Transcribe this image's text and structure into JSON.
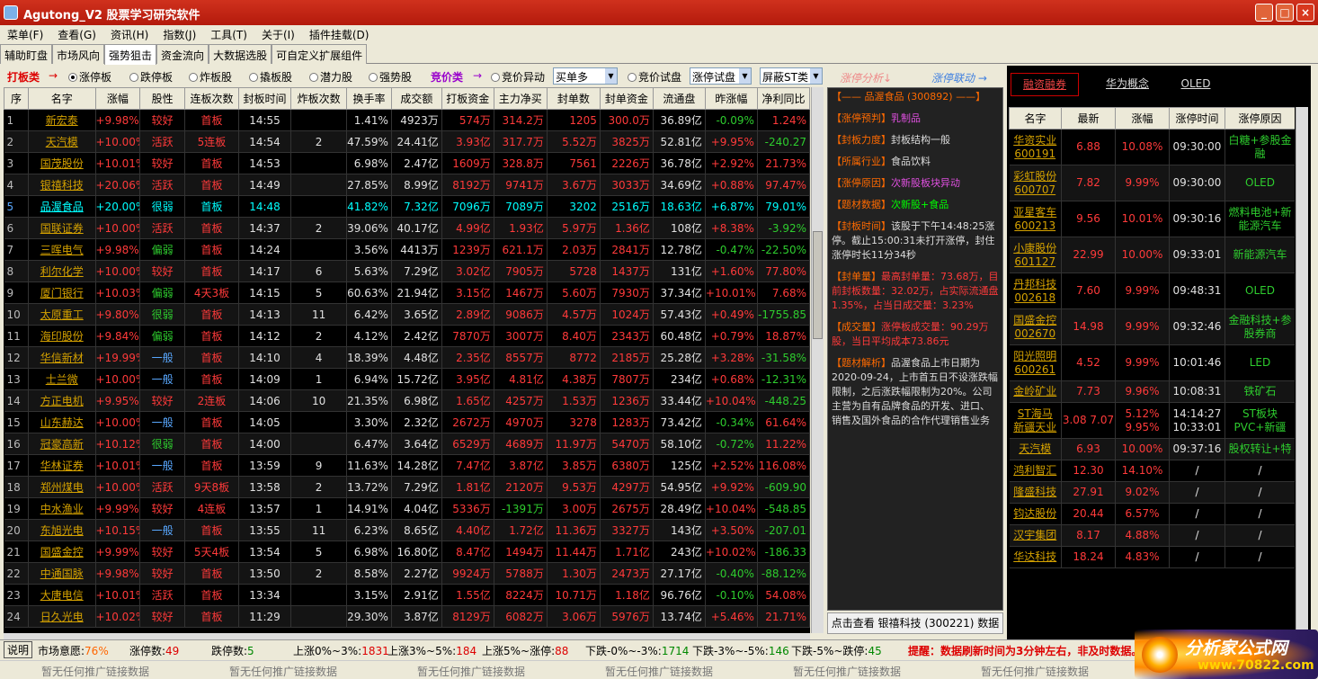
{
  "window": {
    "title": "Agutong_V2 股票学习研究软件",
    "btn_min": "_",
    "btn_max": "□",
    "btn_close": "×"
  },
  "menu": [
    "菜单(F)",
    "查看(G)",
    "资讯(H)",
    "指数(J)",
    "工具(T)",
    "关于(I)",
    "插件挂载(D)"
  ],
  "tabs": [
    "辅助盯盘",
    "市场风向",
    "强势狙击",
    "资金流向",
    "大数据选股",
    "可自定义扩展组件"
  ],
  "filters": {
    "dabanlei": "打板类",
    "arrow1": "→",
    "r1": "涨停板",
    "r2": "跌停板",
    "r3": "炸板股",
    "r4": "撬板股",
    "r5": "潜力股",
    "r6": "强势股",
    "jingjialei": "竞价类",
    "arrow2": "→",
    "r7": "竞价异动",
    "sel1": "买单多",
    "r8": "竞价试盘",
    "sel2": "涨停试盘",
    "sel3": "屏蔽ST类"
  },
  "columns": [
    "序",
    "名字",
    "涨幅",
    "股性",
    "连板次数",
    "封板时间",
    "炸板次数",
    "换手率",
    "成交额",
    "打板资金",
    "主力净买",
    "封单数",
    "封单资金",
    "流通盘",
    "昨涨幅",
    "净利同比"
  ],
  "rows": [
    [
      "1",
      "新宏泰",
      "+9.98%",
      "较好",
      "首板",
      "14:55",
      "",
      "1.41%",
      "4923万",
      "574万",
      "314.2万",
      "1205",
      "300.0万",
      "36.89亿",
      "-0.09%",
      "1.24%"
    ],
    [
      "2",
      "天汽模",
      "+10.00%",
      "活跃",
      "5连板",
      "14:54",
      "2",
      "47.59%",
      "24.41亿",
      "3.93亿",
      "317.7万",
      "5.52万",
      "3825万",
      "52.81亿",
      "+9.95%",
      "-240.27"
    ],
    [
      "3",
      "国茂股份",
      "+10.01%",
      "较好",
      "首板",
      "14:53",
      "",
      "6.98%",
      "2.47亿",
      "1609万",
      "328.8万",
      "7561",
      "2226万",
      "36.78亿",
      "+2.92%",
      "21.73%"
    ],
    [
      "4",
      "银禧科技",
      "+20.06%",
      "活跃",
      "首板",
      "14:49",
      "",
      "27.85%",
      "8.99亿",
      "8192万",
      "9741万",
      "3.67万",
      "3033万",
      "34.69亿",
      "+0.88%",
      "97.47%"
    ],
    [
      "5",
      "品渥食品",
      "+20.00%",
      "很弱",
      "首板",
      "14:48",
      "",
      "41.82%",
      "7.32亿",
      "7096万",
      "7089万",
      "3202",
      "2516万",
      "18.63亿",
      "+6.87%",
      "79.01%"
    ],
    [
      "6",
      "国联证券",
      "+10.00%",
      "活跃",
      "首板",
      "14:37",
      "2",
      "39.06%",
      "40.17亿",
      "4.99亿",
      "1.93亿",
      "5.97万",
      "1.36亿",
      "108亿",
      "+8.38%",
      "-3.92%"
    ],
    [
      "7",
      "三晖电气",
      "+9.98%",
      "偏弱",
      "首板",
      "14:24",
      "",
      "3.56%",
      "4413万",
      "1239万",
      "621.1万",
      "2.03万",
      "2841万",
      "12.78亿",
      "-0.47%",
      "-22.50%"
    ],
    [
      "8",
      "利尔化学",
      "+10.00%",
      "较好",
      "首板",
      "14:17",
      "6",
      "5.63%",
      "7.29亿",
      "3.02亿",
      "7905万",
      "5728",
      "1437万",
      "131亿",
      "+1.60%",
      "77.80%"
    ],
    [
      "9",
      "厦门银行",
      "+10.03%",
      "偏弱",
      "4天3板",
      "14:15",
      "5",
      "60.63%",
      "21.94亿",
      "3.15亿",
      "1467万",
      "5.60万",
      "7930万",
      "37.34亿",
      "+10.01%",
      "7.68%"
    ],
    [
      "10",
      "太原重工",
      "+9.80%",
      "很弱",
      "首板",
      "14:13",
      "11",
      "6.42%",
      "3.65亿",
      "2.89亿",
      "9086万",
      "4.57万",
      "1024万",
      "57.43亿",
      "+0.49%",
      "-1755.85"
    ],
    [
      "11",
      "海印股份",
      "+9.84%",
      "偏弱",
      "首板",
      "14:12",
      "2",
      "4.12%",
      "2.42亿",
      "7870万",
      "3007万",
      "8.40万",
      "2343万",
      "60.48亿",
      "+0.79%",
      "18.87%"
    ],
    [
      "12",
      "华信新材",
      "+19.99%",
      "一般",
      "首板",
      "14:10",
      "4",
      "18.39%",
      "4.48亿",
      "2.35亿",
      "8557万",
      "8772",
      "2185万",
      "25.28亿",
      "+3.28%",
      "-31.58%"
    ],
    [
      "13",
      "士兰微",
      "+10.00%",
      "一般",
      "首板",
      "14:09",
      "1",
      "6.94%",
      "15.72亿",
      "3.95亿",
      "4.81亿",
      "4.38万",
      "7807万",
      "234亿",
      "+0.68%",
      "-12.31%"
    ],
    [
      "14",
      "方正电机",
      "+9.95%",
      "较好",
      "2连板",
      "14:06",
      "10",
      "21.35%",
      "6.98亿",
      "1.65亿",
      "4257万",
      "1.53万",
      "1236万",
      "33.44亿",
      "+10.04%",
      "-448.25"
    ],
    [
      "15",
      "山东赫达",
      "+10.00%",
      "一般",
      "首板",
      "14:05",
      "",
      "3.30%",
      "2.32亿",
      "2672万",
      "4970万",
      "3278",
      "1283万",
      "73.42亿",
      "-0.34%",
      "61.64%"
    ],
    [
      "16",
      "冠豪高新",
      "+10.12%",
      "很弱",
      "首板",
      "14:00",
      "",
      "6.47%",
      "3.64亿",
      "6529万",
      "4689万",
      "11.97万",
      "5470万",
      "58.10亿",
      "-0.72%",
      "11.22%"
    ],
    [
      "17",
      "华林证券",
      "+10.01%",
      "一般",
      "首板",
      "13:59",
      "9",
      "11.63%",
      "14.28亿",
      "7.47亿",
      "3.87亿",
      "3.85万",
      "6380万",
      "125亿",
      "+2.52%",
      "116.08%"
    ],
    [
      "18",
      "郑州煤电",
      "+10.00%",
      "活跃",
      "9天8板",
      "13:58",
      "2",
      "13.72%",
      "7.29亿",
      "1.81亿",
      "2120万",
      "9.53万",
      "4297万",
      "54.95亿",
      "+9.92%",
      "-609.90"
    ],
    [
      "19",
      "中水渔业",
      "+9.99%",
      "较好",
      "4连板",
      "13:57",
      "1",
      "14.91%",
      "4.04亿",
      "5336万",
      "-1391万",
      "3.00万",
      "2675万",
      "28.49亿",
      "+10.04%",
      "-548.85"
    ],
    [
      "20",
      "东旭光电",
      "+10.15%",
      "一般",
      "首板",
      "13:55",
      "11",
      "6.23%",
      "8.65亿",
      "4.40亿",
      "1.72亿",
      "11.36万",
      "3327万",
      "143亿",
      "+3.50%",
      "-207.01"
    ],
    [
      "21",
      "国盛金控",
      "+9.99%",
      "较好",
      "5天4板",
      "13:54",
      "5",
      "6.98%",
      "16.80亿",
      "8.47亿",
      "1494万",
      "11.44万",
      "1.71亿",
      "243亿",
      "+10.02%",
      "-186.33"
    ],
    [
      "22",
      "中通国脉",
      "+9.98%",
      "较好",
      "首板",
      "13:50",
      "2",
      "8.58%",
      "2.27亿",
      "9924万",
      "5788万",
      "1.30万",
      "2473万",
      "27.17亿",
      "-0.40%",
      "-88.12%"
    ],
    [
      "23",
      "大唐电信",
      "+10.01%",
      "活跃",
      "首板",
      "13:34",
      "",
      "3.15%",
      "2.91亿",
      "1.55亿",
      "8224万",
      "10.71万",
      "1.18亿",
      "96.76亿",
      "-0.10%",
      "54.08%"
    ],
    [
      "24",
      "日久光电",
      "+10.02%",
      "较好",
      "首板",
      "11:29",
      "",
      "29.30%",
      "3.87亿",
      "8129万",
      "6082万",
      "3.06万",
      "5976万",
      "13.74亿",
      "+5.46%",
      "21.71%"
    ]
  ],
  "mid": {
    "hdr_left": "涨停分析↓",
    "hdr_right": "涨停联动 →",
    "title": "【—— 品渥食品 (300892) ——】",
    "k1": "【涨停预判】",
    "v1": "乳制品",
    "k2": "【封板力度】",
    "v2": "封板结构一般",
    "k3": "【所属行业】",
    "v3": "食品饮料",
    "k4": "【涨停原因】",
    "v4": "次新股板块异动",
    "k5": "【题材数据】",
    "v5": "次新股+食品",
    "k6": "【封板时间】",
    "v6": "该股于下午14:48:25涨停。截止15:00:31未打开涨停，封住涨停时长11分34秒",
    "k7": "【封单量】",
    "v7": "最高封单量：73.68万，目前封板数量：32.02万，占实际流通盘1.35%，占当日成交量：3.23%",
    "k8": "【成交量】",
    "v8": "涨停板成交量：90.29万股，当日平均成本73.86元",
    "k9": "【题材解析】",
    "v9": "品渥食品上市日期为2020-09-24，上市首五日不设涨跌幅限制，之后涨跌幅限制为20%。公司主营为自有品牌食品的开发、进口、销售及国外食品的合作代理销售业务",
    "btn": "点击查看 银禧科技 (300221) 数据"
  },
  "right": {
    "tabs": [
      "融资融券",
      "华为概念",
      "OLED"
    ],
    "columns": [
      "名字",
      "最新",
      "涨幅",
      "涨停时间",
      "涨停原因"
    ],
    "rows": [
      [
        "华资实业",
        "600191",
        "6.88",
        "10.08%",
        "09:30:00",
        "白糖+参股金融"
      ],
      [
        "彩虹股份",
        "600707",
        "7.82",
        "9.99%",
        "09:30:00",
        "OLED"
      ],
      [
        "亚星客车",
        "600213",
        "9.56",
        "10.01%",
        "09:30:16",
        "燃料电池+新能源汽车"
      ],
      [
        "小康股份",
        "601127",
        "22.99",
        "10.00%",
        "09:33:01",
        "新能源汽车"
      ],
      [
        "丹邦科技",
        "002618",
        "7.60",
        "9.99%",
        "09:48:31",
        "OLED"
      ],
      [
        "国盛金控",
        "002670",
        "14.98",
        "9.99%",
        "09:32:46",
        "金融科技+参股券商"
      ],
      [
        "阳光照明",
        "600261",
        "4.52",
        "9.99%",
        "10:01:46",
        "LED"
      ],
      [
        "金岭矿业",
        "",
        "7.73",
        "9.96%",
        "10:08:31",
        "铁矿石"
      ],
      [
        "ST海马",
        "新疆天业",
        "3.08 7.07",
        "5.12% 9.95%",
        "14:14:27 10:33:01",
        "ST板块 PVC+新疆"
      ],
      [
        "天汽模",
        "",
        "6.93",
        "10.00%",
        "09:37:16",
        "股权转让+特"
      ],
      [
        "鸿利智汇",
        "",
        "12.30",
        "14.10%",
        "/",
        "/"
      ],
      [
        "隆盛科技",
        "",
        "27.91",
        "9.02%",
        "/",
        "/"
      ],
      [
        "钧达股份",
        "",
        "20.44",
        "6.57%",
        "/",
        "/"
      ],
      [
        "汉宇集团",
        "",
        "8.17",
        "4.88%",
        "/",
        "/"
      ],
      [
        "华达科技",
        "",
        "18.24",
        "4.83%",
        "/",
        "/"
      ]
    ]
  },
  "status": {
    "help": "说明",
    "s1k": "市场意愿:",
    "s1v": "76%",
    "s2k": "涨停数:",
    "s2v": "49",
    "s3k": "跌停数:",
    "s3v": "5",
    "s4k": "上涨0%~3%:",
    "s4v": "1831",
    "s5k": "上涨3%~5%:",
    "s5v": "184",
    "s6k": "上涨5%~涨停:",
    "s6v": "88",
    "s7k": "下跌-0%~-3%:",
    "s7v": "1714",
    "s8k": "下跌-3%~-5%:",
    "s8v": "146",
    "s9k": "下跌-5%~跌停:",
    "s9v": "45",
    "notice": "提醒：数据刷新时间为3分钟左右，非及时数据。"
  },
  "ad": "暂无任何推广链接数据",
  "logo": {
    "t1": "分析家公式网",
    "t2": "www.70822.com"
  }
}
